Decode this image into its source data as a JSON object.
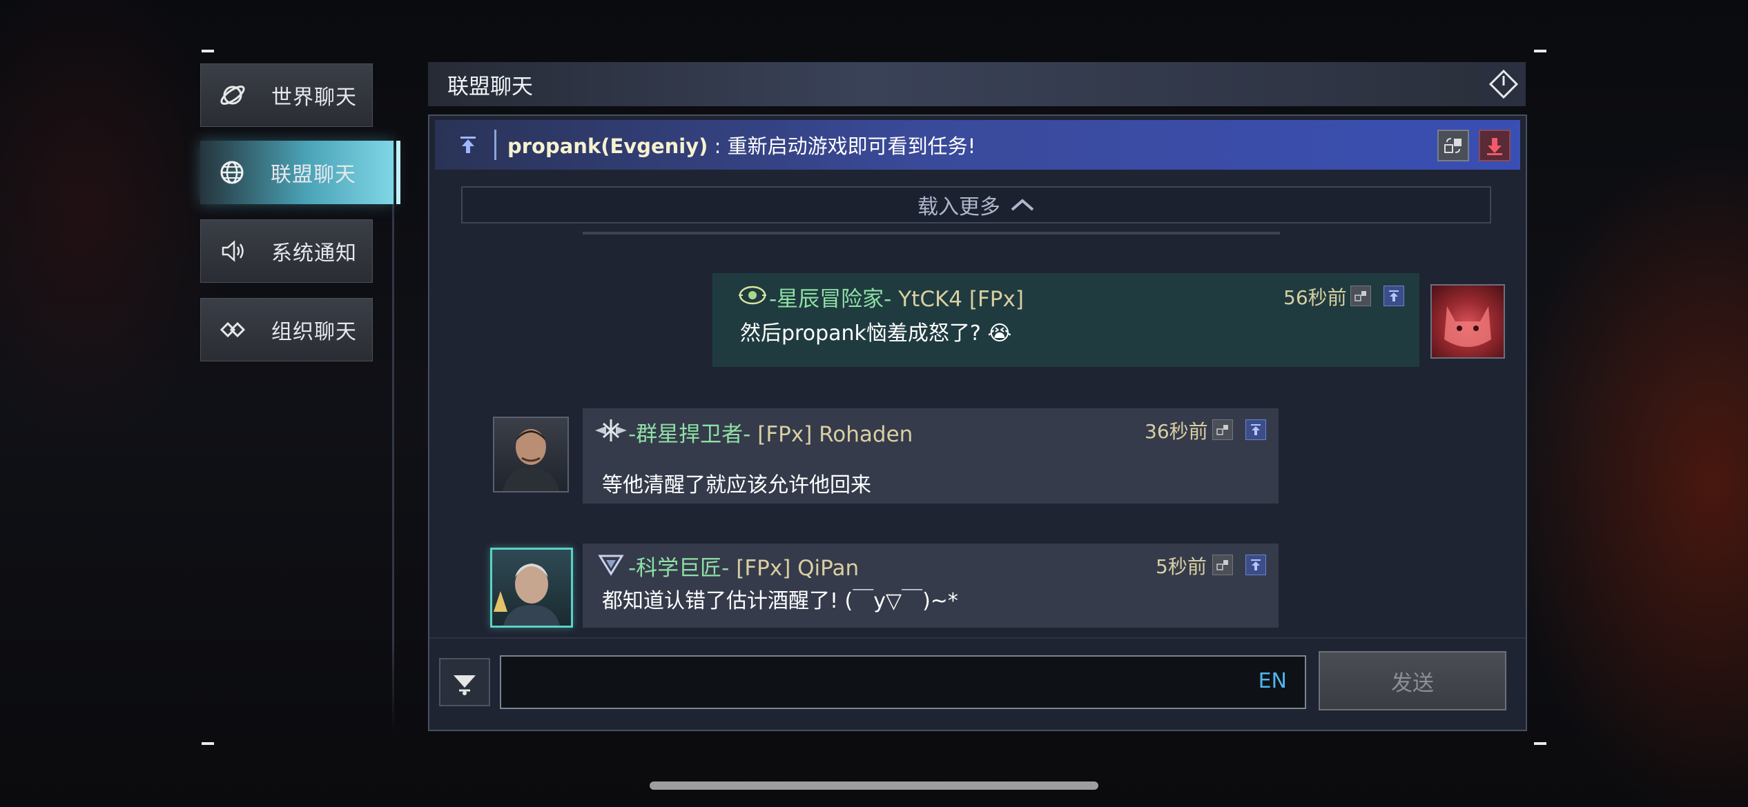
{
  "sidebar": {
    "items": [
      {
        "label": "世界聊天",
        "icon": "planet-icon",
        "active": false
      },
      {
        "label": "联盟聊天",
        "icon": "globe-icon",
        "active": true
      },
      {
        "label": "系统通知",
        "icon": "speaker-icon",
        "active": false
      },
      {
        "label": "组织聊天",
        "icon": "link-diamond-icon",
        "active": false
      }
    ]
  },
  "header": {
    "title": "联盟聊天",
    "exit_icon": "exit-diamond-icon"
  },
  "pinned": {
    "author": "propank(Evgeniy)",
    "separator": " : ",
    "text": "重新启动游戏即可看到任务!",
    "pin_icon": "pin-up-icon",
    "tools": [
      "translate-icon",
      "download-icon"
    ]
  },
  "chat": {
    "load_more": "载入更多",
    "messages": [
      {
        "side": "right",
        "title": "-星辰冒险家-",
        "player": "YtCK4 [FPx]",
        "time": "56秒前",
        "text": "然后propank恼羞成怒了? 😭",
        "avatar": "cat-avatar",
        "badge": "eye-badge-icon"
      },
      {
        "side": "left",
        "title": "-群星捍卫者-",
        "player": "[FPx] Rohaden",
        "time": "36秒前",
        "text": "等他清醒了就应该允许他回来",
        "avatar": "man-avatar",
        "badge": "wings-badge-icon"
      },
      {
        "side": "left",
        "title": "-科学巨匠-",
        "player": "[FPx] QiPan",
        "time": "5秒前",
        "text": "都知道认错了估计酒醒了! (￣y▽￣)~*",
        "avatar": "elder-avatar",
        "badge": "triangle-badge-icon"
      }
    ]
  },
  "composer": {
    "value": "",
    "lang": "EN",
    "send_label": "发送",
    "emoji_icon": "emoji-arrow-icon"
  },
  "colors": {
    "accent": "#7fd6e6",
    "title_green": "#8fe0a6",
    "time_gold": "#d9cfa2",
    "pinned_blue": "#3a4fb4"
  }
}
